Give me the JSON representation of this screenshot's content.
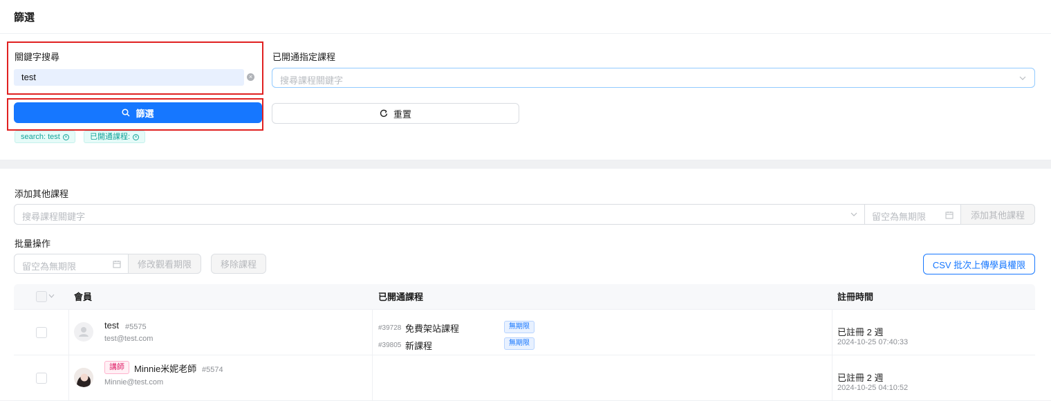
{
  "filter": {
    "title": "篩選",
    "keyword_label": "關鍵字搜尋",
    "keyword_value": "test",
    "course_label": "已開通指定課程",
    "course_placeholder": "搜尋課程關鍵字",
    "filter_button": "篩選",
    "reset_button": "重置",
    "active_tags": [
      "search: test",
      "已開通課程:"
    ]
  },
  "add_course": {
    "label": "添加其他課程",
    "search_placeholder": "搜尋課程關鍵字",
    "date_placeholder": "留空為無期限",
    "add_button": "添加其他課程"
  },
  "batch": {
    "label": "批量操作",
    "date_placeholder": "留空為無期限",
    "modify_button": "修改觀看期限",
    "remove_button": "移除課程",
    "csv_button": "CSV 批次上傳學員權限"
  },
  "table": {
    "headers": {
      "member": "會員",
      "courses": "已開通課程",
      "registered": "註冊時間"
    },
    "rows": [
      {
        "name": "test",
        "id": "#5575",
        "email": "test@test.com",
        "role": "",
        "courses": [
          {
            "id": "#39728",
            "name": "免費架站課程",
            "limit": "無期限"
          },
          {
            "id": "#39805",
            "name": "新課程",
            "limit": "無期限"
          }
        ],
        "registered_relative": "已註冊 2 週",
        "registered_at": "2024-10-25 07:40:33"
      },
      {
        "name": "Minnie米妮老師",
        "id": "#5574",
        "email": "Minnie@test.com",
        "role": "講師",
        "courses": [],
        "registered_relative": "已註冊 2 週",
        "registered_at": "2024-10-25 04:10:52"
      }
    ]
  },
  "colors": {
    "primary": "#1677ff",
    "highlight": "#e02020",
    "tag_green": "#13a39a"
  }
}
